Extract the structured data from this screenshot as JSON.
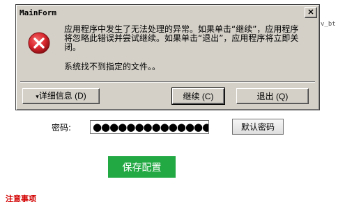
{
  "background": {
    "fragment": "v_bt",
    "password_label": "密码:",
    "password_value": "●●●●●●●●●●●●●●●●",
    "default_password_button": "默认密码",
    "save_button": "保存配置",
    "notice_prefix": "注意事项"
  },
  "dialog": {
    "title": "MainForm",
    "close_glyph": "✕",
    "icon": "error-icon",
    "message_main": "应用程序中发生了无法处理的异常。如果单击“继续”，应用程序将忽略此错误并尝试继续。如果单击“退出”，应用程序将立即关闭。",
    "message_detail": "系统找不到指定的文件。。",
    "buttons": {
      "details_chevron": "▾",
      "details": "详细信息 (D)",
      "continue": "继续 (C)",
      "quit": "退出 (Q)"
    }
  },
  "colors": {
    "dialog_bg": "#d4d0c8",
    "error_red": "#d9272e",
    "save_green": "#23a944",
    "notice_red": "#d30000"
  }
}
